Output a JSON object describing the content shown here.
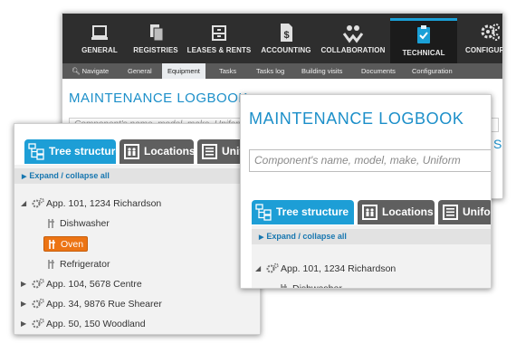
{
  "back_window": {
    "top_nav": [
      {
        "label": "GENERAL",
        "icon": "monitor-icon"
      },
      {
        "label": "REGISTRIES",
        "icon": "documents-icon"
      },
      {
        "label": "LEASES & RENTS",
        "icon": "cabinet-icon"
      },
      {
        "label": "ACCOUNTING",
        "icon": "dollar-document-icon"
      },
      {
        "label": "COLLABORATION",
        "icon": "hands-people-icon"
      },
      {
        "label": "TECHNICAL",
        "icon": "clipboard-check-icon",
        "active": true
      },
      {
        "label": "CONFIGURATI",
        "icon": "gears-icon"
      }
    ],
    "sub_nav": [
      "Navigate",
      "General",
      "Equipment",
      "Tasks",
      "Tasks log",
      "Building visits",
      "Documents",
      "Configuration"
    ],
    "sub_nav_active": "Equipment",
    "title": "MAINTENANCE LOGBOOK",
    "search_placeholder": "Component's name, model, make, Uniformat",
    "right_glyph": "S"
  },
  "left_window": {
    "tabs": [
      "Tree structure",
      "Locations",
      "Unifo"
    ],
    "expand_label": "Expand / collapse all",
    "tree": [
      {
        "label": "App. 101, 1234 Richardson",
        "expanded": true,
        "children": [
          "Dishwasher",
          "Oven",
          "Refrigerator"
        ],
        "selected": "Oven"
      },
      {
        "label": "App. 104, 5678 Centre",
        "expanded": false
      },
      {
        "label": "App. 34, 9876 Rue Shearer",
        "expanded": false
      },
      {
        "label": "App. 50, 150 Woodland",
        "expanded": false
      }
    ]
  },
  "front_window": {
    "title": "MAINTENANCE LOGBOOK",
    "search_placeholder": "Component's name, model, make, Uniform",
    "right_glyph": "S",
    "tabs": [
      "Tree structure",
      "Locations",
      "Unifo"
    ],
    "expand_label": "Expand / collapse all",
    "tree": [
      {
        "label": "App. 101, 1234 Richardson",
        "expanded": true,
        "children": [
          "Dishwasher"
        ]
      }
    ]
  },
  "colors": {
    "accent_blue": "#1d9ed6",
    "title_blue": "#1c8fc9",
    "selected_orange": "#ec7414",
    "tab_gray": "#5f5f5f",
    "nav_dark": "#2e2e2e"
  }
}
